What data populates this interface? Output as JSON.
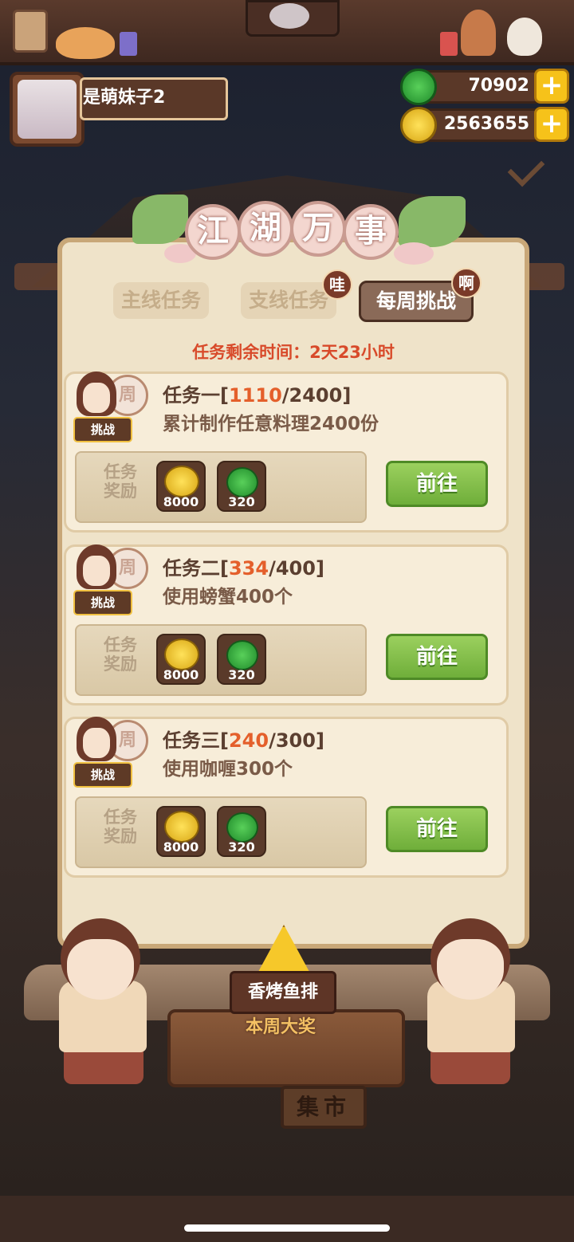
{
  "player": {
    "name": "是萌妹子2"
  },
  "resources": {
    "jade": "70902",
    "coins": "2563655",
    "plus_symbol": "+"
  },
  "panel": {
    "title_chars": [
      "江",
      "湖",
      "万",
      "事"
    ],
    "tabs": [
      {
        "label": "主线任务",
        "active": false,
        "badge": ""
      },
      {
        "label": "支线任务",
        "active": false,
        "badge": "哇"
      },
      {
        "label": "每周挑战",
        "active": true,
        "badge": "啊"
      }
    ],
    "timer": "任务剩余时间：2天23小时"
  },
  "tasks": [
    {
      "name": "任务一",
      "current": "1110",
      "total": "2400",
      "description": "累计制作任意料理2400份",
      "badge": "挑战",
      "stamp": "周",
      "reward_label_1": "任务",
      "reward_label_2": "奖励",
      "rewards": [
        {
          "icon": "coin-icon",
          "value": "8000"
        },
        {
          "icon": "jade-icon",
          "value": "320"
        }
      ],
      "button": "前往"
    },
    {
      "name": "任务二",
      "current": "334",
      "total": "400",
      "description": "使用螃蟹400个",
      "badge": "挑战",
      "stamp": "周",
      "reward_label_1": "任务",
      "reward_label_2": "奖励",
      "rewards": [
        {
          "icon": "coin-icon",
          "value": "8000"
        },
        {
          "icon": "jade-icon",
          "value": "320"
        }
      ],
      "button": "前往"
    },
    {
      "name": "任务三",
      "current": "240",
      "total": "300",
      "description": "使用咖喱300个",
      "badge": "挑战",
      "stamp": "周",
      "reward_label_1": "任务",
      "reward_label_2": "奖励",
      "rewards": [
        {
          "icon": "coin-icon",
          "value": "8000"
        },
        {
          "icon": "jade-icon",
          "value": "320"
        }
      ],
      "button": "前往"
    }
  ],
  "prize": {
    "name": "香烤鱼排",
    "label": "本周大奖"
  },
  "scene": {
    "market_sign": "集市"
  },
  "colors": {
    "progress_current": "#e45f2b",
    "timer_text": "#d84a2a",
    "go_button": "#7ab844",
    "panel_bg": "#efe3c9"
  }
}
